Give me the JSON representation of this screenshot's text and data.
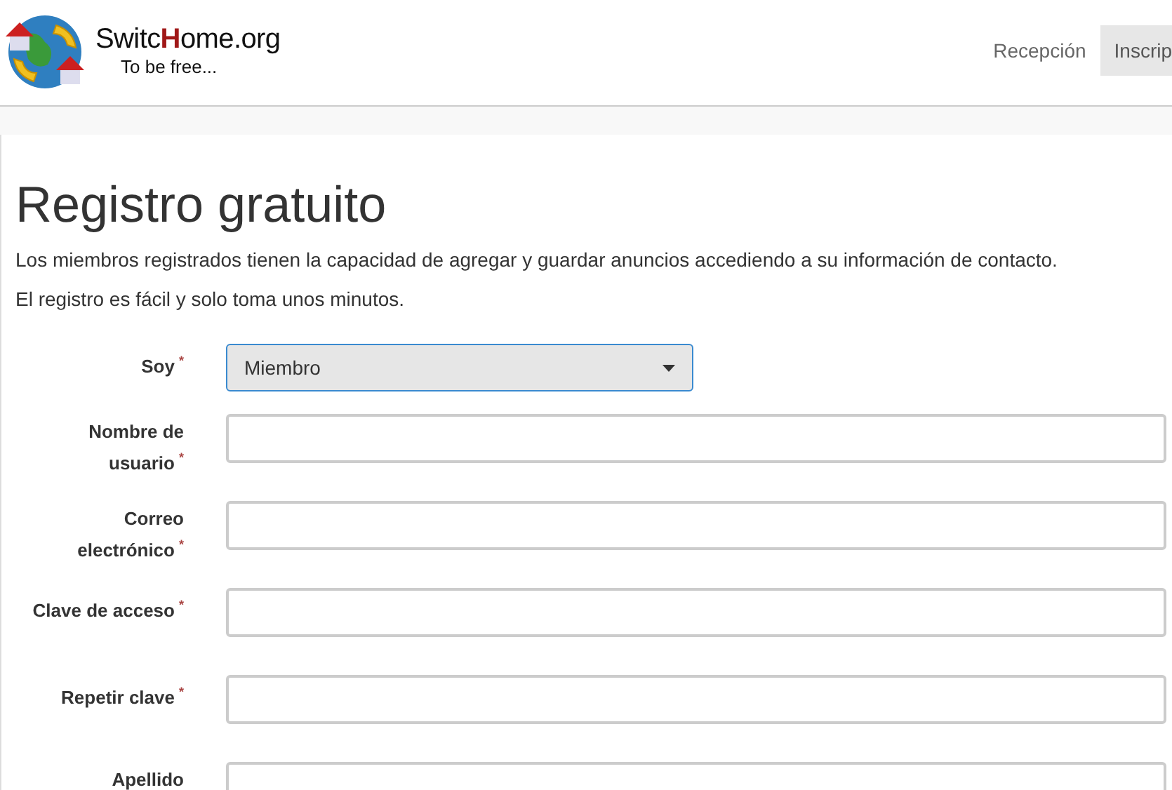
{
  "brand": {
    "name_parts": [
      {
        "text": "Switc",
        "highlight": false
      },
      {
        "text": "H",
        "highlight": true
      },
      {
        "text": "ome.org",
        "highlight": false
      }
    ],
    "tagline": "To be free..."
  },
  "nav": [
    {
      "label": "Recepción",
      "selected": false
    },
    {
      "label": "Inscrip",
      "selected": true
    }
  ],
  "page": {
    "title": "Registro gratuito",
    "paragraphs": [
      "Los miembros registrados tienen la capacidad de agregar y guardar anuncios accediendo a su información de contacto.",
      "El registro es fácil y solo toma unos minutos."
    ]
  },
  "form": [
    {
      "kind": "select",
      "label": "Soy",
      "required_mark": "*",
      "value": "Miembro"
    },
    {
      "kind": "text",
      "label": "Nombre de usuario",
      "required_mark": "*"
    },
    {
      "kind": "text",
      "label": "Correo electrónico",
      "required_mark": "*"
    },
    {
      "kind": "text",
      "label": "Clave de acceso",
      "required_mark": "*"
    },
    {
      "kind": "text",
      "label": "Repetir clave",
      "required_mark": "*"
    },
    {
      "kind": "text",
      "label": "Apellido"
    }
  ]
}
